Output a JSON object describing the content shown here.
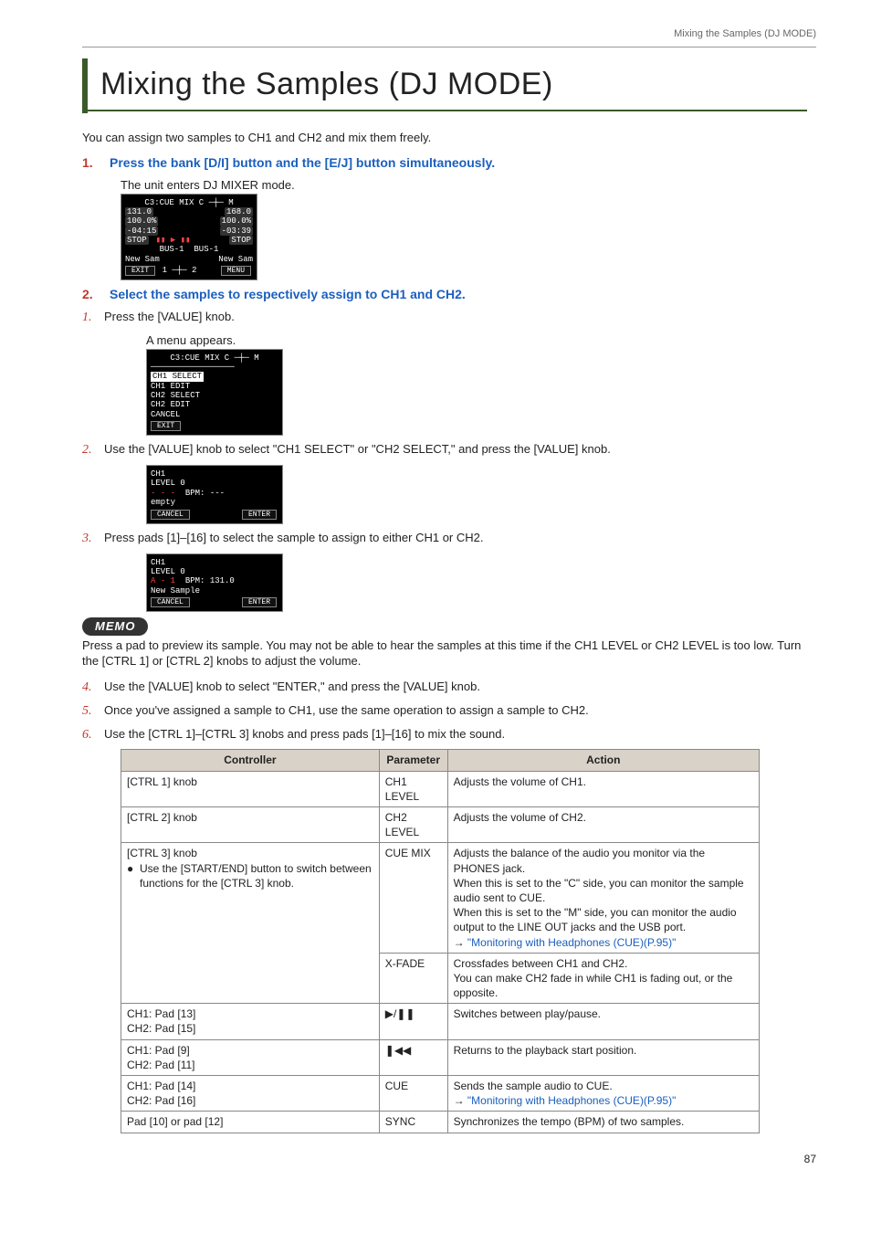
{
  "running_head": "Mixing the Samples (DJ MODE)",
  "title": "Mixing the Samples (DJ MODE)",
  "intro": "You can assign two samples to CH1 and CH2 and mix them freely.",
  "step1": {
    "num": "1.",
    "text": "Press the bank [D/I] button and the [E/J] button simultaneously.",
    "caption": "The unit enters DJ MIXER mode."
  },
  "scr1": {
    "header": "C3:CUE MIX  C ─┼─ M",
    "l1a": "131.0",
    "l1b": "168.0",
    "l2a": "100.0%",
    "l2b": "100.0%",
    "l3a": "-04:15",
    "l3b": "-03:39",
    "l4a": "STOP",
    "l4b": "STOP",
    "l5a": "BUS-1",
    "l5b": "BUS-1",
    "l6a": "New Sam",
    "l6b": "New Sam",
    "exit": "EXIT",
    "menu": "MENU"
  },
  "step2": {
    "num": "2.",
    "text": "Select the samples to respectively assign to CH1 and CH2."
  },
  "sub1": {
    "num": "1.",
    "text": "Press the [VALUE] knob.",
    "caption": "A menu appears."
  },
  "scr2": {
    "header": "C3:CUE MIX  C ─┼─ M",
    "i1": "CH1 SELECT",
    "i2": "CH1 EDIT",
    "i3": "CH2 SELECT",
    "i4": "CH2 EDIT",
    "i5": "CANCEL",
    "exit": "EXIT"
  },
  "sub2": {
    "num": "2.",
    "text": "Use the [VALUE] knob to select \"CH1 SELECT\" or \"CH2 SELECT,\" and press the [VALUE] knob."
  },
  "scr3": {
    "l1": "CH1",
    "l2": "LEVEL 0",
    "l3a": "- - -",
    "l3b": "BPM: ---",
    "l4": "empty",
    "cancel": "CANCEL",
    "enter": "ENTER"
  },
  "sub3": {
    "num": "3.",
    "text": "Press pads [1]–[16] to select the sample to assign to either CH1 or CH2."
  },
  "scr4": {
    "l1": "CH1",
    "l2": "LEVEL 0",
    "l3a": "A - 1",
    "l3b": "BPM: 131.0",
    "l4": "New Sample",
    "cancel": "CANCEL",
    "enter": "ENTER"
  },
  "memo": {
    "label": "MEMO",
    "text": "Press a pad to preview its sample. You may not be able to hear the samples at this time if the CH1 LEVEL or CH2 LEVEL is too low. Turn the [CTRL 1] or [CTRL 2] knobs to adjust the volume."
  },
  "sub4": {
    "num": "4.",
    "text": "Use the [VALUE] knob to select \"ENTER,\" and press the [VALUE] knob."
  },
  "sub5": {
    "num": "5.",
    "text": "Once you've assigned a sample to CH1, use the same operation to assign a sample to CH2."
  },
  "sub6": {
    "num": "6.",
    "text": "Use the [CTRL 1]–[CTRL 3] knobs and press pads [1]–[16] to mix the sound."
  },
  "table": {
    "head": {
      "c1": "Controller",
      "c2": "Parameter",
      "c3": "Action"
    },
    "rows": [
      {
        "c1": "[CTRL 1] knob",
        "c2": "CH1 LEVEL",
        "c3": "Adjusts the volume of CH1."
      },
      {
        "c1": "[CTRL 2] knob",
        "c2": "CH2 LEVEL",
        "c3": "Adjusts the volume of CH2."
      },
      {
        "c1_main": "[CTRL 3] knob",
        "c1_bullet": "Use the [START/END] button to switch between functions for the [CTRL 3] knob.",
        "c2": "CUE MIX",
        "c3_a": "Adjusts the balance of the audio you monitor via the PHONES jack.",
        "c3_b": "When this is set to the \"C\" side, you can monitor the sample audio sent to CUE.",
        "c3_c": "When this is set to the \"M\" side, you can monitor the audio output to the LINE OUT jacks and the USB port.",
        "c3_link_pre": "→  ",
        "c3_link": "\"Monitoring with Headphones (CUE)(P.95)\""
      },
      {
        "c1": "",
        "c2": "X-FADE",
        "c3_a": "Crossfades between CH1 and CH2.",
        "c3_b": "You can make CH2 fade in while CH1 is fading out, or the opposite."
      },
      {
        "c1_a": "CH1: Pad [13]",
        "c1_b": "CH2: Pad [15]",
        "c2": "▶/❚❚",
        "c3": "Switches between play/pause."
      },
      {
        "c1_a": "CH1: Pad [9]",
        "c1_b": "CH2: Pad [11]",
        "c2": "❚◀◀",
        "c3": "Returns to the playback start position."
      },
      {
        "c1_a": "CH1: Pad [14]",
        "c1_b": "CH2: Pad [16]",
        "c2": "CUE",
        "c3_a": "Sends the sample audio to CUE.",
        "c3_link_pre": "→  ",
        "c3_link": "\"Monitoring with Headphones (CUE)(P.95)\""
      },
      {
        "c1": "Pad [10] or pad [12]",
        "c2": "SYNC",
        "c3": "Synchronizes the tempo (BPM) of two samples."
      }
    ]
  },
  "page_num": "87"
}
